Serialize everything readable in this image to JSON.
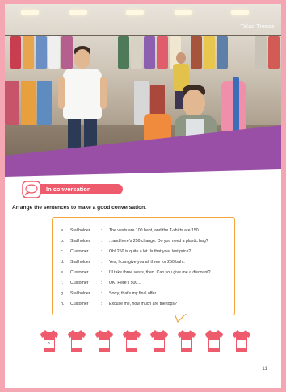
{
  "header": {
    "title_tag": "Talad Trends"
  },
  "section": {
    "title": "In conversation"
  },
  "instruction": "Arrange the sentences to make a good conversation.",
  "conversation": [
    {
      "letter": "a.",
      "speaker": "Stallholder",
      "text": "The vests are 100 baht, and the T-shirts are 150."
    },
    {
      "letter": "b.",
      "speaker": "Stallholder",
      "text": "...and here's 250 change. Do you need a plastic bag?"
    },
    {
      "letter": "c.",
      "speaker": "Customer",
      "text": "Oh! 250 is quite a lot. Is that your last price?"
    },
    {
      "letter": "d.",
      "speaker": "Stallholder",
      "text": "Yes, I can give you all three for 250 baht."
    },
    {
      "letter": "e.",
      "speaker": "Customer",
      "text": "I'll take three vests, then. Can you give me a discount?"
    },
    {
      "letter": "f.",
      "speaker": "Customer",
      "text": "OK. Here's 500..."
    },
    {
      "letter": "g.",
      "speaker": "Stallholder",
      "text": "Sorry, that's my final offer."
    },
    {
      "letter": "h.",
      "speaker": "Customer",
      "text": "Excuse me, how much are the tops?"
    }
  ],
  "answers": [
    {
      "number": "1",
      "answer": "h."
    },
    {
      "number": "2",
      "answer": ""
    },
    {
      "number": "3",
      "answer": ""
    },
    {
      "number": "4",
      "answer": ""
    },
    {
      "number": "5",
      "answer": ""
    },
    {
      "number": "6",
      "answer": ""
    },
    {
      "number": "7",
      "answer": ""
    },
    {
      "number": "8",
      "answer": ""
    }
  ],
  "page_number": "11",
  "colors": {
    "border": "#f4a7b2",
    "accent_pink": "#ee5b6c",
    "accent_orange": "#f2a63b",
    "purple": "#9a4fa6"
  },
  "icons": {
    "section_icon": "speech-bubble-icon",
    "answer_slot": "t-shirt-icon"
  }
}
